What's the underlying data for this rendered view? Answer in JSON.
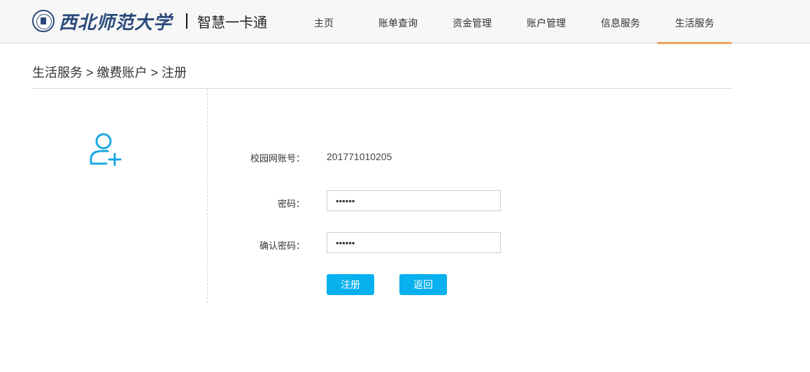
{
  "header": {
    "university_name": "西北师范大学",
    "system_name": "智慧一卡通"
  },
  "nav": {
    "items": [
      {
        "label": "主页"
      },
      {
        "label": "账单查询"
      },
      {
        "label": "资金管理"
      },
      {
        "label": "账户管理"
      },
      {
        "label": "信息服务"
      },
      {
        "label": "生活服务",
        "active": true
      }
    ],
    "active_underline_color": "#f0a35e"
  },
  "breadcrumb": {
    "text": "生活服务 > 缴费账户 > 注册"
  },
  "icons": {
    "seal": "university-seal-icon",
    "add_user": "add-user-icon",
    "add_user_color": "#1ba9e1"
  },
  "form": {
    "account_label": "校园网账号：",
    "account_value": "201771010205",
    "password_label": "密码：",
    "password_value": "••••••",
    "confirm_label": "确认密码：",
    "confirm_value": "••••••"
  },
  "buttons": {
    "register": "注册",
    "back": "返回",
    "color": "#09b0ee"
  }
}
